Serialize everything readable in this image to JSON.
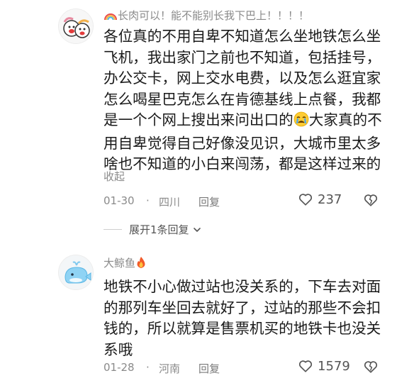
{
  "comments": [
    {
      "username": "长肉可以！能不能别长我下巴上！！！！",
      "username_emoji": "rainbow",
      "avatar_icon": "cartoon-duo-avatar",
      "lines": [
        "各位真的不用自卑不知道怎么坐地铁怎么坐",
        "飞机，我出家门之前也不知道，包括挂号，",
        "办公交卡，网上交水电费，以及怎么逛宜家",
        "怎么喝星巴克怎么在肯德基线上点餐，我都",
        "是一个个网上搜出来问出口的",
        "大家真的不",
        "用自卑觉得自己好像没见识，大城市里太多",
        "啥也不知道的小白来闯荡，都是这样过来的"
      ],
      "line5_emoji": "crying-face",
      "collapse_label": "收起",
      "date": "01-30",
      "separator": "·",
      "location": "四川",
      "reply_label": "回复",
      "like_count": "237",
      "expand_label": "展开1条回复"
    },
    {
      "username": "大鲸鱼",
      "username_emoji": "fire",
      "avatar_icon": "whale-avatar",
      "lines": [
        "地铁不小心做过站也没关系的，下车去对面",
        "的那列车坐回去就好了，过站的那些不会扣",
        "钱的，所以就算是售票机买的地铁卡也没关",
        "系哦"
      ],
      "date": "01-28",
      "separator": "·",
      "location": "河南",
      "reply_label": "回复",
      "like_count": "1579"
    }
  ],
  "colors": {
    "text": "#1a1a1a",
    "meta": "#8a8a8a",
    "icon": "#555555"
  }
}
